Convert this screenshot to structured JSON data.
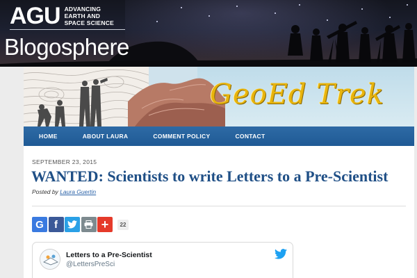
{
  "site": {
    "logo": "AGU",
    "tagline_lines": [
      "ADVANCING",
      "EARTH AND",
      "SPACE SCIENCE"
    ],
    "network_title": "Blogosphere"
  },
  "blog": {
    "title": "GeoEd Trek",
    "title_color": "#e8b40c"
  },
  "nav": {
    "items": [
      "HOME",
      "ABOUT LAURA",
      "COMMENT POLICY",
      "CONTACT"
    ],
    "bar_color": "#2562a0"
  },
  "post": {
    "date": "SEPTEMBER 23, 2015",
    "title": "WANTED: Scientists to write Letters to a Pre-Scientist",
    "byline_prefix": "Posted by",
    "author": "Laura Guertin",
    "title_color": "#1f4f86"
  },
  "share": {
    "buttons": [
      {
        "icon": "google-icon",
        "label": "G",
        "color": "#3a7ae0"
      },
      {
        "icon": "facebook-icon",
        "label": "f",
        "color": "#3b5998"
      },
      {
        "icon": "twitter-icon",
        "color": "#2aa0e6"
      },
      {
        "icon": "print-icon",
        "color": "#7d8a8f"
      },
      {
        "icon": "plus-icon",
        "label": "+",
        "color": "#e53a2a"
      }
    ],
    "count": "22"
  },
  "tweet_embed": {
    "name": "Letters to a Pre-Scientist",
    "handle": "@LettersPreSci",
    "icon": "twitter-bird-icon"
  }
}
